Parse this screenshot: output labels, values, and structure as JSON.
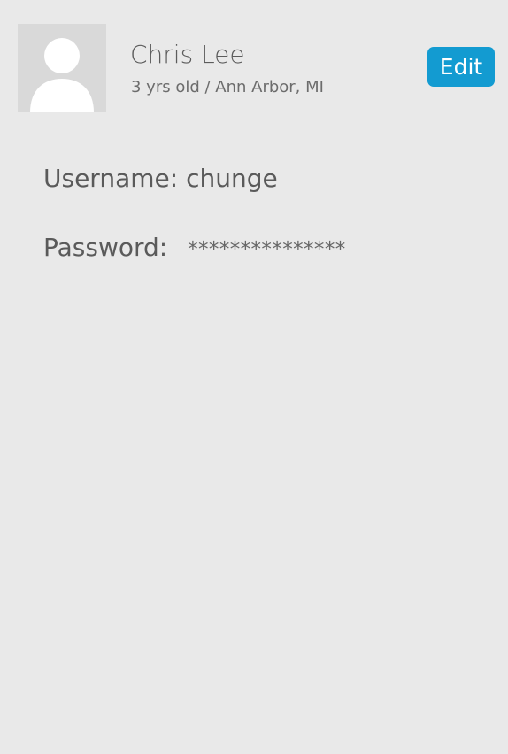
{
  "profile": {
    "name": "Chris Lee",
    "subtitle": "3 yrs old / Ann Arbor, MI",
    "avatar_icon": "user-silhouette-icon"
  },
  "actions": {
    "edit_label": "Edit"
  },
  "fields": {
    "username_label": "Username:",
    "username_value": "chunge",
    "password_label": "Password:",
    "password_value": "***************"
  },
  "colors": {
    "background": "#e9e9e9",
    "avatar_bg": "#d9d9d9",
    "avatar_fg": "#ffffff",
    "accent": "#139bd1",
    "text": "#5a5a5a"
  }
}
